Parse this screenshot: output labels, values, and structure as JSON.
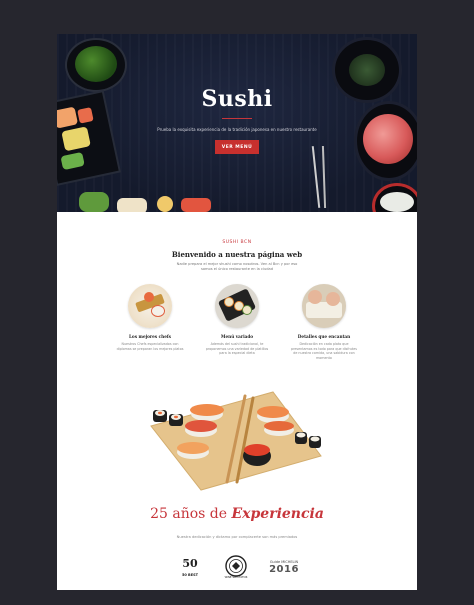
{
  "hero": {
    "title": "Sushi",
    "subtitle": "Prueba la exquisita experiencia de la tradición japonesa en nuestro restaurante",
    "button_label": "VER MENÚ"
  },
  "welcome": {
    "kicker": "SUSHI BCN",
    "title": "Bienvenido a nuestra página web",
    "text": "Nadie prepara el mejor shushi como nosotros. Ven al Bcn y por eso somos el único restaurante en la ciudad"
  },
  "features": [
    {
      "title": "Los mejores chefs",
      "desc": "Nuestros Chefs especializados con diplomas se preparan los mejores platos"
    },
    {
      "title": "Menú variado",
      "desc": "Además del sushi tradicional, te proponemos una variedad de platillos para la especial dieta"
    },
    {
      "title": "Detalles que encantan",
      "desc": "Dedicación en cada plato que presentamos es todo para que disfrutes de nuestra comida, una sabidura con momento"
    }
  ],
  "experience": {
    "years": "25 años de",
    "word": "Experiencia",
    "subtitle": "Nuestra dedicación y dictamo por complacerte son más premiados"
  },
  "awards": {
    "fifty_best": "50 BEST",
    "michelin_label": "Guide MICHELIN",
    "michelin_year": "2016",
    "wine_label": "WINE SPECTATOR"
  },
  "colors": {
    "accent": "#c7363b",
    "hero_bg": "#141a2c",
    "page_bg": "#26262e"
  }
}
